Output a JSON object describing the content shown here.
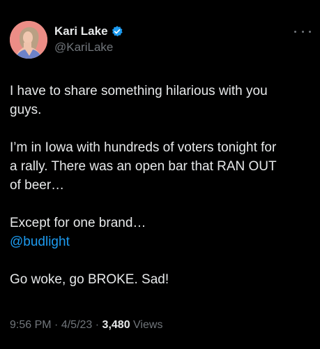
{
  "author": {
    "display_name": "Kari Lake",
    "handle": "@KariLake",
    "verified": true
  },
  "icons": {
    "avatar": "profile-photo",
    "verified": "verified-badge-icon",
    "more": "more-options-icon"
  },
  "colors": {
    "background": "#000000",
    "text": "#e7e9ea",
    "secondary_text": "#71767b",
    "mention": "#1d9bf0",
    "verified_badge": "#1d9bf0"
  },
  "tweet": {
    "p1": {
      "l1": "I have to share something hilarious with you",
      "l2": "guys."
    },
    "p2": {
      "l1": "I’m in Iowa with hundreds of voters tonight for",
      "l2": "a rally. There was an open bar that RAN OUT",
      "l3": "of beer…"
    },
    "p3": {
      "l1": "Except for one brand…",
      "mention": "@budlight"
    },
    "p4": {
      "l1": "Go woke, go BROKE. Sad!"
    }
  },
  "meta": {
    "time": "9:56 PM",
    "separator": "·",
    "date": "4/5/23",
    "view_count": "3,480",
    "views_label": "Views"
  }
}
